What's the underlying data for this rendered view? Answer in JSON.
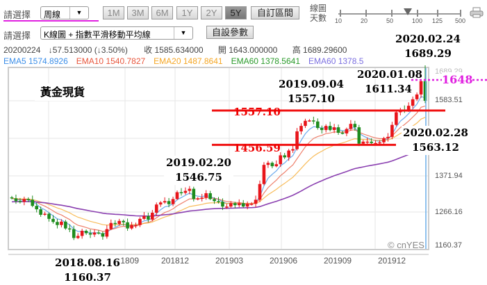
{
  "toolbar": {
    "select_label": "請選擇",
    "period_value": "周線",
    "range_buttons": [
      "1M",
      "3M",
      "6M",
      "1Y",
      "2Y",
      "5Y"
    ],
    "active_range": "5Y",
    "custom_range": "自訂區間",
    "days_label_1": "線圖",
    "days_label_2": "天數",
    "days_ticks": [
      "10",
      "20",
      "50",
      "100",
      "125",
      "500"
    ],
    "days_value": "100",
    "chart_type_label": "請選擇",
    "chart_type_value": "K線圖 + 指數平滑移動平均線",
    "settings_button": "自設參數"
  },
  "quote": {
    "date": "20200224",
    "change": "↓57.513000 (↓3.50%)",
    "close": "收 1585.634000",
    "open": "開 1643.000000",
    "high": "高 1689.29600"
  },
  "legend": [
    {
      "label": "EMA5 1574.8926",
      "color": "#3b8ee8"
    },
    {
      "label": "EMA10 1540.7827",
      "color": "#e8553b"
    },
    {
      "label": "EMA20 1487.8641",
      "color": "#f5a623"
    },
    {
      "label": "EMA60 1378.5641",
      "color": "#2a9a2a"
    },
    {
      "label": "EMA60 1378.5",
      "color": "#7b6fe0"
    }
  ],
  "annotations": {
    "title": "黃金現貨",
    "top_date": "2020.02.24",
    "top_value": "1689.29",
    "jan_date": "2020.01.08",
    "jan_value": "1611.34",
    "sep_date": "2019.09.04",
    "sep_value": "1557.10",
    "feb28_date": "2020.02.28",
    "feb28_value": "1563.12",
    "feb19_date": "2019.02.20",
    "feb19_value": "1546.75",
    "aug_date": "2018.08.16",
    "aug_value": "1160.37",
    "line_upper": "1557.10",
    "line_lower": "1456.59",
    "line_target": "1648"
  },
  "watermark": "© cnYES",
  "chart_data": {
    "type": "candlestick",
    "interval": "weekly",
    "ylim": [
      1160.37,
      1689.29
    ],
    "y_ticks": [
      "1689.29",
      "1583.51",
      "1371.94",
      "1266.16",
      "1160.37"
    ],
    "x_ticks": [
      "201809",
      "201812",
      "201903",
      "201906",
      "201909",
      "201912"
    ],
    "closes": [
      1300,
      1292,
      1290,
      1298,
      1296,
      1278,
      1268,
      1252,
      1255,
      1240,
      1231,
      1222,
      1232,
      1212,
      1210,
      1184,
      1190,
      1205,
      1198,
      1194,
      1200,
      1198,
      1188,
      1210,
      1228,
      1225,
      1234,
      1230,
      1212,
      1222,
      1222,
      1240,
      1248,
      1238,
      1258,
      1282,
      1288,
      1292,
      1283,
      1298,
      1318,
      1316,
      1322,
      1328,
      1298,
      1300,
      1302,
      1315,
      1298,
      1292,
      1290,
      1276,
      1276,
      1286,
      1280,
      1286,
      1276,
      1284,
      1284,
      1296,
      1342,
      1398,
      1404,
      1394,
      1400,
      1426,
      1420,
      1440,
      1444,
      1496,
      1512,
      1527,
      1528,
      1525,
      1506,
      1500,
      1512,
      1500,
      1508,
      1492,
      1490,
      1503,
      1518,
      1508,
      1460,
      1466,
      1466,
      1462,
      1462,
      1464,
      1476,
      1480,
      1515,
      1552,
      1560,
      1556,
      1571,
      1590,
      1604,
      1643,
      1585.63
    ],
    "last_candle": {
      "open": 1643,
      "high": 1689.29,
      "close": 1585.63
    },
    "ema_periods": [
      5,
      10,
      20,
      60
    ],
    "levels": [
      1557.1,
      1456.59,
      1648
    ]
  }
}
